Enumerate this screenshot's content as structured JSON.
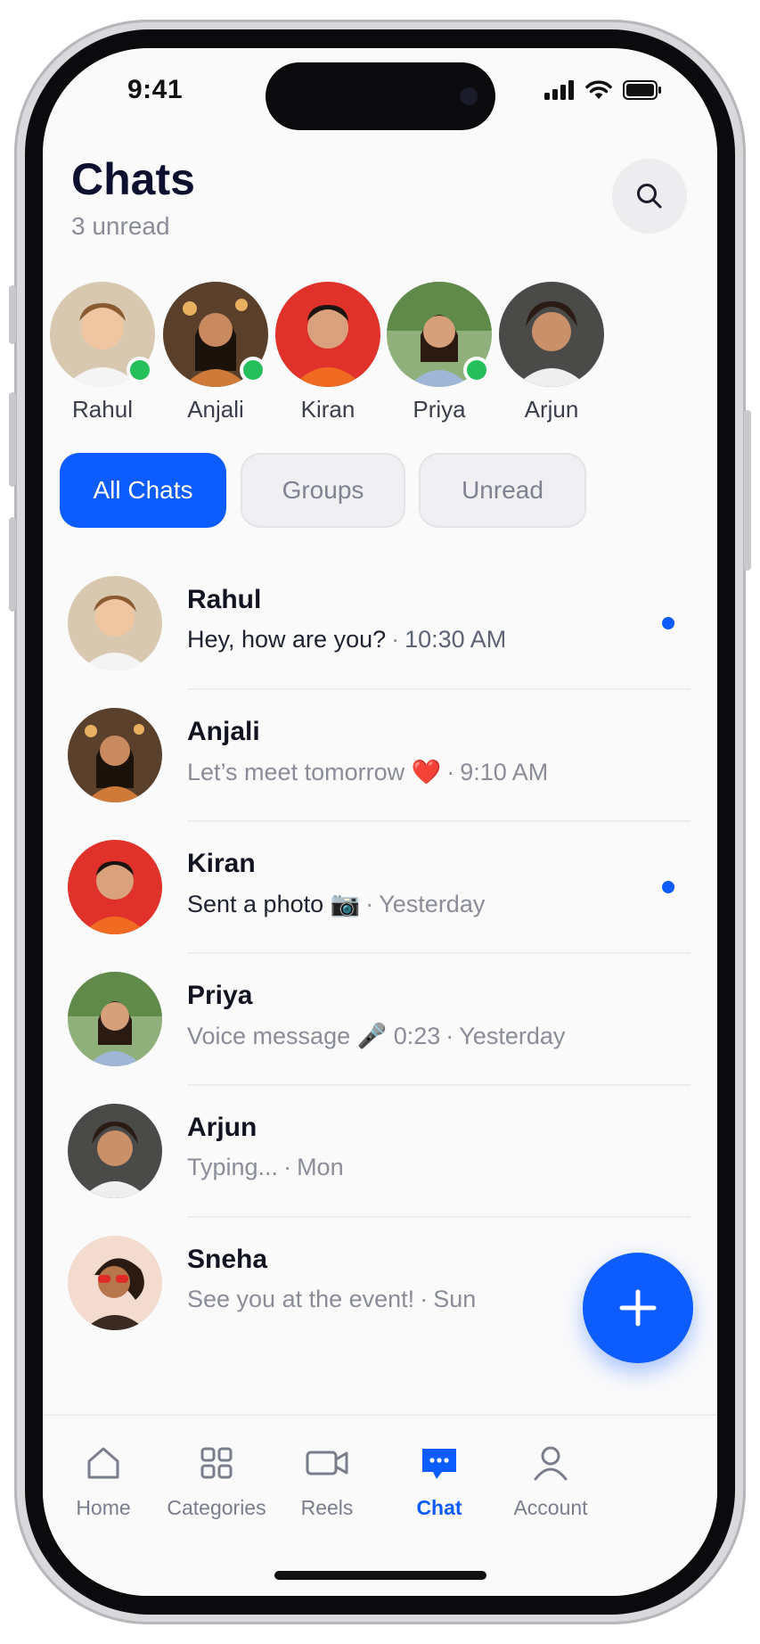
{
  "status_bar": {
    "time": "9:41"
  },
  "header": {
    "title": "Chats",
    "subtitle": "3 unread",
    "search_icon": "search-icon"
  },
  "stories": [
    {
      "name": "Rahul",
      "online": true
    },
    {
      "name": "Anjali",
      "online": true
    },
    {
      "name": "Kiran",
      "online": false
    },
    {
      "name": "Priya",
      "online": true
    },
    {
      "name": "Arjun",
      "online": false
    }
  ],
  "filters": [
    {
      "label": "All Chats",
      "active": true
    },
    {
      "label": "Groups",
      "active": false
    },
    {
      "label": "Unread",
      "active": false
    }
  ],
  "chats": [
    {
      "name": "Rahul",
      "message": "Hey, how are you?",
      "time": "10:30 AM",
      "unread": true
    },
    {
      "name": "Anjali",
      "message": "Let’s meet tomorrow ❤️",
      "time": "9:10 AM",
      "unread": false
    },
    {
      "name": "Kiran",
      "message": "Sent a photo 📷",
      "time": "Yesterday",
      "unread": true
    },
    {
      "name": "Priya",
      "message": "Voice message 🎤 0:23",
      "time": "Yesterday",
      "unread": false
    },
    {
      "name": "Arjun",
      "message": "Typing...",
      "time": "Mon",
      "unread": false
    },
    {
      "name": "Sneha",
      "message": "See you at the event!",
      "time": "Sun",
      "unread": false
    }
  ],
  "tabs": [
    {
      "label": "Home",
      "icon": "home-icon"
    },
    {
      "label": "Categories",
      "icon": "grid-icon"
    },
    {
      "label": "Reels",
      "icon": "video-icon"
    },
    {
      "label": "Chat",
      "icon": "chat-bubble-icon",
      "active": true
    },
    {
      "label": "Account",
      "icon": "user-icon"
    }
  ],
  "colors": {
    "accent": "#0d5cff",
    "online": "#25c05b",
    "title": "#0e1030",
    "muted": "#8a8d98"
  }
}
